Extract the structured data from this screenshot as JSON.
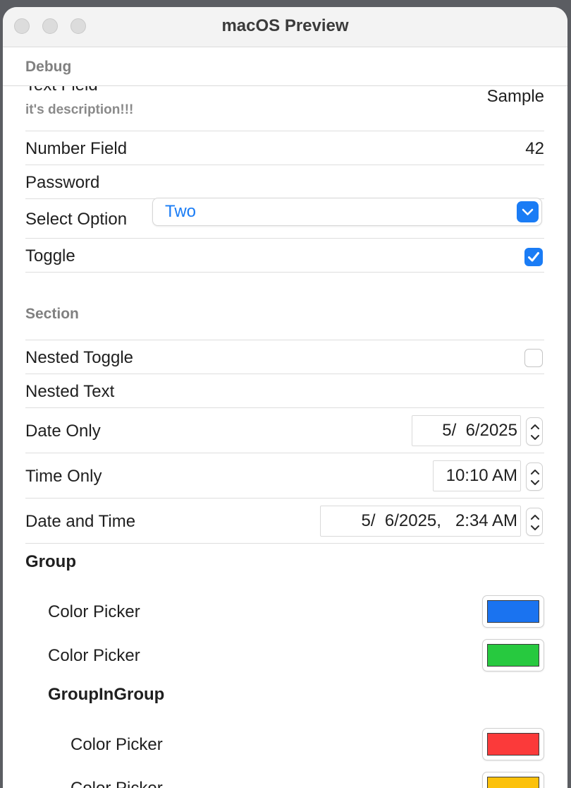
{
  "window": {
    "title": "macOS Preview"
  },
  "debug": {
    "header": "Debug",
    "text_field": {
      "label": "Text Field",
      "description": "it's description!!!",
      "value": "Sample"
    },
    "number_field": {
      "label": "Number Field",
      "value": "42"
    },
    "password": {
      "label": "Password"
    },
    "select": {
      "label": "Select Option",
      "value": "Two"
    },
    "toggle": {
      "label": "Toggle",
      "checked": true
    }
  },
  "section": {
    "header": "Section",
    "nested_toggle": {
      "label": "Nested Toggle",
      "checked": false
    },
    "nested_text": {
      "label": "Nested Text"
    },
    "date_only": {
      "label": "Date Only",
      "value": "5/  6/2025"
    },
    "time_only": {
      "label": "Time Only",
      "value": "10:10 AM"
    },
    "date_time": {
      "label": "Date and Time",
      "value": "5/  6/2025,   2:34 AM"
    }
  },
  "group": {
    "title": "Group",
    "pickers": [
      {
        "label": "Color Picker",
        "color": "#1a73f0"
      },
      {
        "label": "Color Picker",
        "color": "#27c93f"
      }
    ],
    "inner": {
      "title": "GroupInGroup",
      "pickers": [
        {
          "label": "Color Picker",
          "color": "#fb3a3a"
        },
        {
          "label": "Color Picker",
          "color": "#fcc10b"
        }
      ]
    }
  },
  "colors": {
    "accent": "#1a7cf5",
    "window_bg": "#ffffff",
    "titlebar_bg": "#f3f3f3"
  },
  "icons": {
    "close": "close-traffic-light",
    "minimize": "minimize-traffic-light",
    "zoom": "zoom-traffic-light",
    "chevron": "chevron-up-down-icon",
    "check": "checkmark-icon",
    "stepper": "stepper-arrows-icon"
  }
}
